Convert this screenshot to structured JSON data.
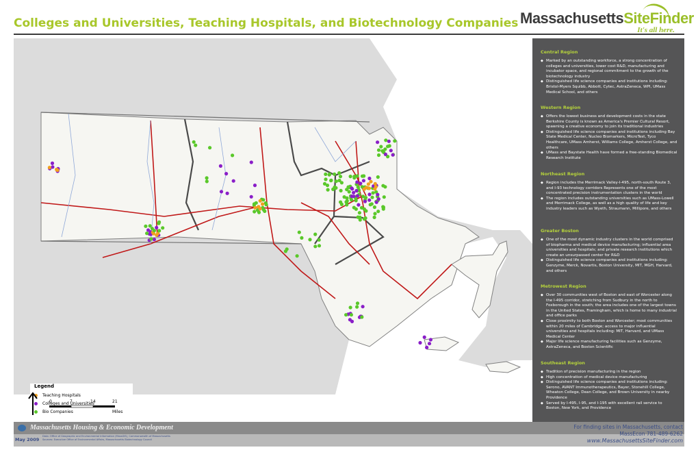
{
  "header": {
    "title": "Colleges and Universities, Teaching Hospitals, and Biotechnology Companies",
    "logo_text_dark": "Massachusetts",
    "logo_text_green": "SiteFinder",
    "logo_tagline": "It's all here."
  },
  "colors": {
    "title_green": "#a8c72a",
    "panel_bg": "#555556",
    "panel_heading": "#b5d23c",
    "teaching_hospital": "#f0a020",
    "college": "#8a1ec8",
    "bio_company": "#5ac82a",
    "highway": "#c01818"
  },
  "regions": [
    {
      "name": "Central Region",
      "bullets": [
        "Marked by an outstanding workforce, a strong concentration of colleges and universities, lower cost R&D, manufacturing and incubator space, and regional commitment to the growth of the biotechnology industry",
        "Distinguished life science companies and institutions including: Bristol-Myers Squibb, Abbott, Cytec, AstraZeneca, WPI, UMass Medical School, and others"
      ]
    },
    {
      "name": "Western Region",
      "bullets": [
        "Offers the lowest business and development costs in the state Berkshire County is known as America's Premier Cultural Resort, spawning a creative economy to join its traditional industries",
        "Distinguished life science companies and institutions including Bay State Medical Center, Nucleo Biomarkers, MicroTest, Tyco Healthcare, UMass Amherst, Williams College, Amherst College, and others",
        "UMass and Baystate Health have formed a free-standing Biomedical Research Institute"
      ]
    },
    {
      "name": "Northeast Region",
      "bullets": [
        "Region includes the Merrimack Valley-I-495, north-south Route 3, and I-93 technology corridors Represents one of the most concentrated precision instrumentation clusters in the world",
        "The region includes outstanding universities such as UMass-Lowell and Merrimack College, as well as a high quality of life and key industry leaders such as Wyeth, Straumann, Millipore, and others"
      ]
    },
    {
      "name": "Greater Boston",
      "bullets": [
        "One of the most dynamic industry clusters in the world comprised of biopharma and medical device manufacturing; influential area universities and hospitals; and private research institutions which create an unsurpassed center for R&D",
        "Distinguished life science companies and institutions including: Genzyme, Merck, Novartis, Boston University, MIT, MGH, Harvard, and others"
      ]
    },
    {
      "name": "Metrowest Region",
      "bullets": [
        "Over 30 communities west of Boston and east of Worcester along the I-495 corridor, stretching from Sudbury in the north to Foxborough in the south; the area includes one of the largest towns in the United States, Framingham, which is home to many industrial and office parks",
        "Close proximity to both Boston and Worcester; most communities within 20 miles of Cambridge; access to major influential universities and hospitals including: MIT, Harvard, and UMass Medical Center",
        "Major life science manufacturing facilities such as Genzyme, AstraZeneca, and Boston Scientific"
      ]
    },
    {
      "name": "Southeast Region",
      "bullets": [
        "Tradition of precision manufacturing in the region",
        "High concentration of medical device manufacturing",
        "Distinguished life science companies and institutions including: Serono, AVANT Immunotherapeutics, Bayer, Stonehill College, Wheaton College, Dean College, and Brown University in nearby Providence",
        "Served by I-495, I-95, and I-195 with excellent rail service to Boston, New York, and Providence"
      ]
    }
  ],
  "legend": {
    "title": "Legend",
    "items": [
      {
        "label": "Teaching Hospitals",
        "color": "#f0a020"
      },
      {
        "label": "Colleges and Universities",
        "color": "#8a1ec8"
      },
      {
        "label": "Bio Companies",
        "color": "#5ac82a"
      }
    ]
  },
  "scale": {
    "ticks": [
      "0",
      "7",
      "14",
      "21"
    ],
    "unit": "Miles"
  },
  "footer": {
    "agency": "Massachusetts Housing & Economic Development",
    "date": "May 2009",
    "sources_line1": "Data: Office of Geographic and Environmental Information (MassGIS), Commonwealth of Massachusetts",
    "sources_line2": "Sources: Executive Office of Environmental Affairs, Massachusetts Biotechnology Council",
    "contact_line1": "For finding sites in Massachusetts, contact",
    "contact_line2": "MassEcon 781-489-6262",
    "website": "www.MassachusettsSiteFinder.com"
  }
}
